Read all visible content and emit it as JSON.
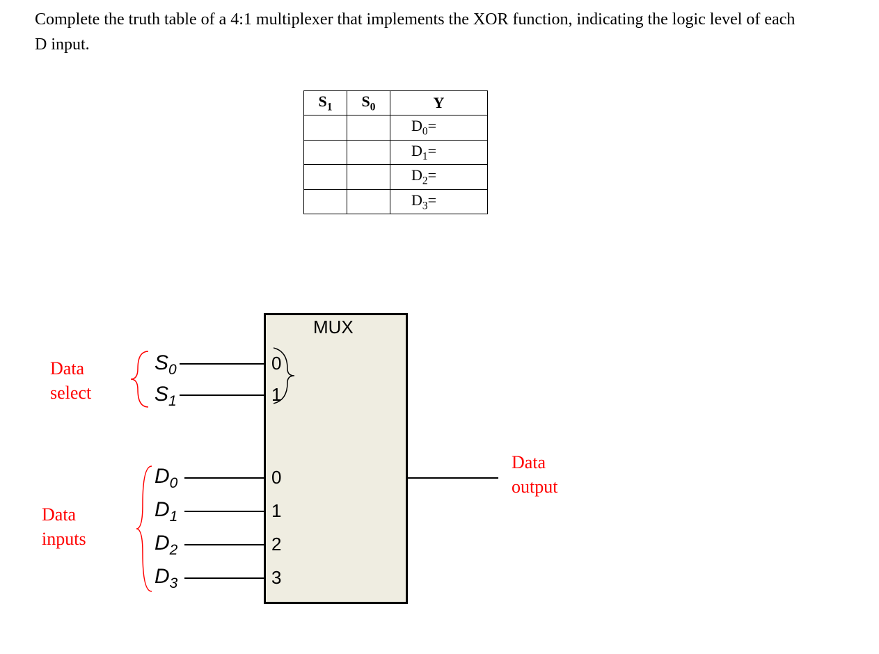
{
  "question": "Complete the truth table of a 4:1 multiplexer that implements the XOR function, indicating the logic level of each D input.",
  "table": {
    "headers": {
      "s1": "S",
      "s1_sub": "1",
      "s0": "S",
      "s0_sub": "0",
      "y": "Y"
    },
    "rows": [
      {
        "s1": "",
        "s0": "",
        "y_prefix": "D",
        "y_sub": "0",
        "y_suffix": "="
      },
      {
        "s1": "",
        "s0": "",
        "y_prefix": "D",
        "y_sub": "1",
        "y_suffix": "="
      },
      {
        "s1": "",
        "s0": "",
        "y_prefix": "D",
        "y_sub": "2",
        "y_suffix": "="
      },
      {
        "s1": "",
        "s0": "",
        "y_prefix": "D",
        "y_sub": "3",
        "y_suffix": "="
      }
    ]
  },
  "diagram": {
    "mux_title": "MUX",
    "select_pins": [
      "0",
      "1"
    ],
    "data_pins": [
      "0",
      "1",
      "2",
      "3"
    ],
    "signals": {
      "s0": "S",
      "s0_sub": "0",
      "s1": "S",
      "s1_sub": "1",
      "d0": "D",
      "d0_sub": "0",
      "d1": "D",
      "d1_sub": "1",
      "d2": "D",
      "d2_sub": "2",
      "d3": "D",
      "d3_sub": "3"
    },
    "annotations": {
      "data_select": "Data\nselect",
      "data_inputs": "Data\ninputs",
      "data_output": "Data\noutput"
    }
  },
  "chart_data": {
    "type": "table",
    "description": "Truth table template for 4:1 MUX implementing XOR with select inputs S1,S0 and output Y wired to data inputs D0-D3",
    "columns": [
      "S1",
      "S0",
      "Y"
    ],
    "rows": [
      [
        "",
        "",
        "D0="
      ],
      [
        "",
        "",
        "D1="
      ],
      [
        "",
        "",
        "D2="
      ],
      [
        "",
        "",
        "D3="
      ]
    ],
    "mux": {
      "type": "4:1",
      "select_lines": [
        "S0",
        "S1"
      ],
      "data_inputs": [
        "D0",
        "D1",
        "D2",
        "D3"
      ],
      "output": "Y"
    }
  }
}
